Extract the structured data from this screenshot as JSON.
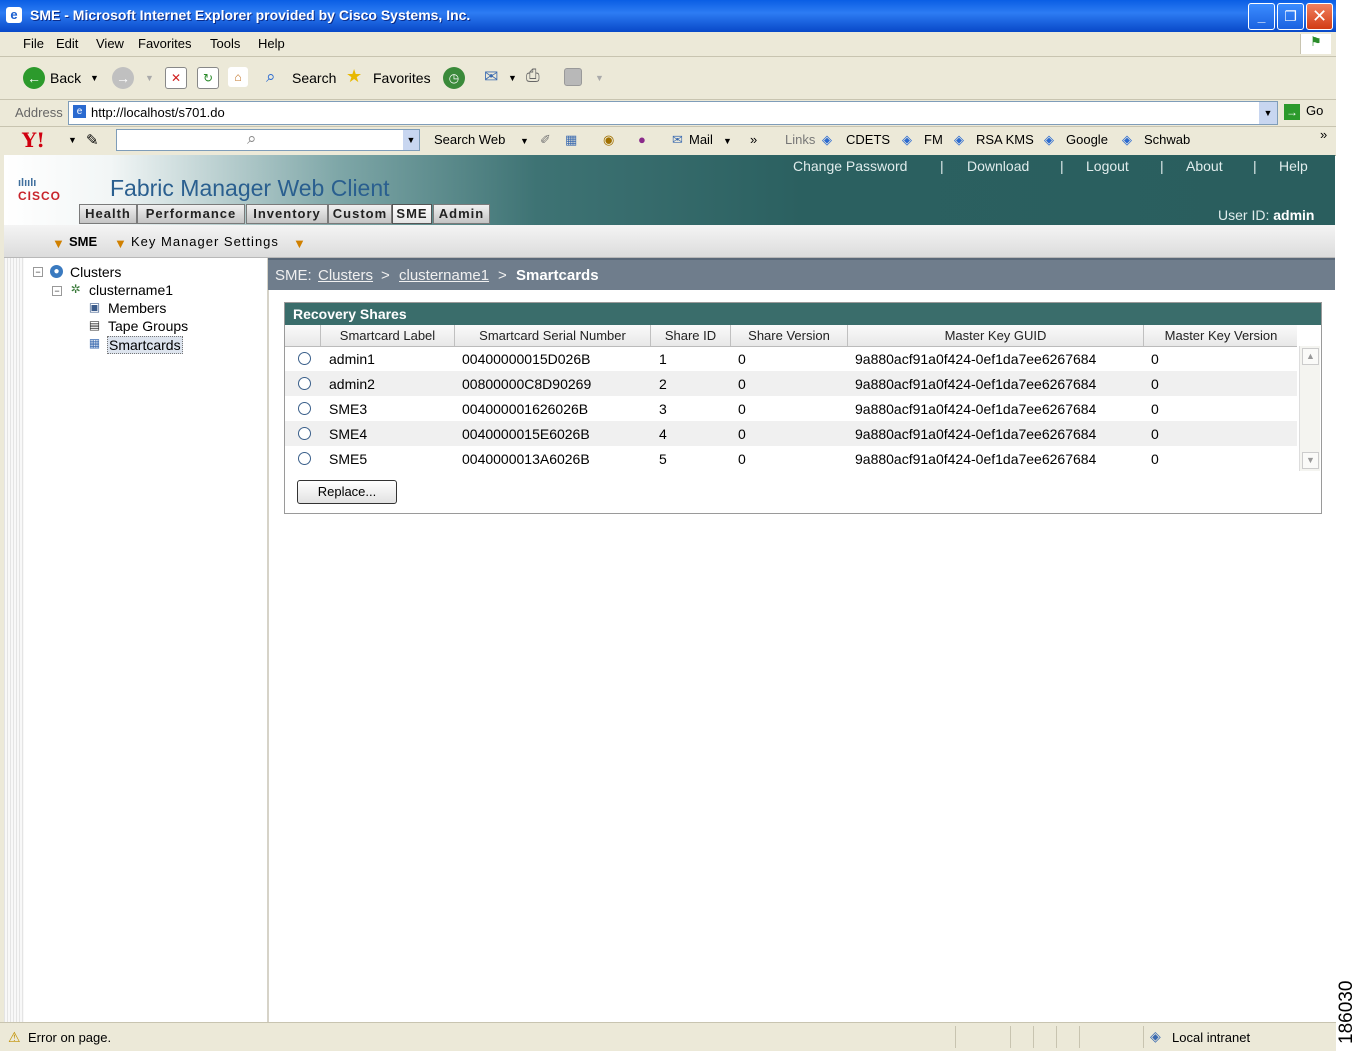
{
  "window": {
    "title": "SME - Microsoft Internet Explorer provided by Cisco Systems, Inc."
  },
  "menubar": [
    "File",
    "Edit",
    "View",
    "Favorites",
    "Tools",
    "Help"
  ],
  "toolbar": {
    "back": "Back",
    "search": "Search",
    "favorites": "Favorites"
  },
  "address": {
    "label": "Address",
    "url": "http://localhost/s701.do",
    "go": "Go"
  },
  "yahoo": {
    "logo": "Y!",
    "search_web": "Search Web",
    "mail": "Mail",
    "links_label": "Links",
    "links": [
      "CDETS",
      "FM",
      "RSA KMS",
      "Google",
      "Schwab"
    ]
  },
  "app": {
    "logo": "CISCO",
    "title": "Fabric Manager Web Client",
    "top_links": [
      "Change Password",
      "Download",
      "Logout",
      "About",
      "Help"
    ],
    "user_label": "User ID:",
    "user": "admin",
    "tabs": [
      "Health",
      "Performance",
      "Inventory",
      "Custom",
      "SME",
      "Admin"
    ],
    "active_tab": "SME",
    "subnav": [
      "SME",
      "Key Manager Settings"
    ]
  },
  "tree": {
    "root": "Clusters",
    "cluster": "clustername1",
    "children": [
      "Members",
      "Tape Groups",
      "Smartcards"
    ],
    "selected": "Smartcards"
  },
  "breadcrumb": {
    "prefix": "SME:",
    "clusters": "Clusters",
    "cluster": "clustername1",
    "current": "Smartcards",
    "sep": ">"
  },
  "panel": {
    "title": "Recovery Shares",
    "columns": [
      "Smartcard Label",
      "Smartcard Serial Number",
      "Share ID",
      "Share Version",
      "Master Key GUID",
      "Master Key Version"
    ],
    "rows": [
      {
        "label": "admin1",
        "serial": "00400000015D026B",
        "share_id": "1",
        "version": "0",
        "guid": "9a880acf91a0f424-0ef1da7ee6267684",
        "mk_version": "0"
      },
      {
        "label": "admin2",
        "serial": "00800000C8D90269",
        "share_id": "2",
        "version": "0",
        "guid": "9a880acf91a0f424-0ef1da7ee6267684",
        "mk_version": "0"
      },
      {
        "label": "SME3",
        "serial": "004000001626026B",
        "share_id": "3",
        "version": "0",
        "guid": "9a880acf91a0f424-0ef1da7ee6267684",
        "mk_version": "0"
      },
      {
        "label": "SME4",
        "serial": "0040000015E6026B",
        "share_id": "4",
        "version": "0",
        "guid": "9a880acf91a0f424-0ef1da7ee6267684",
        "mk_version": "0"
      },
      {
        "label": "SME5",
        "serial": "0040000013A6026B",
        "share_id": "5",
        "version": "0",
        "guid": "9a880acf91a0f424-0ef1da7ee6267684",
        "mk_version": "0"
      }
    ],
    "replace_button": "Replace..."
  },
  "status": {
    "left": "Error on page.",
    "zone": "Local intranet"
  },
  "figure_number": "186030"
}
